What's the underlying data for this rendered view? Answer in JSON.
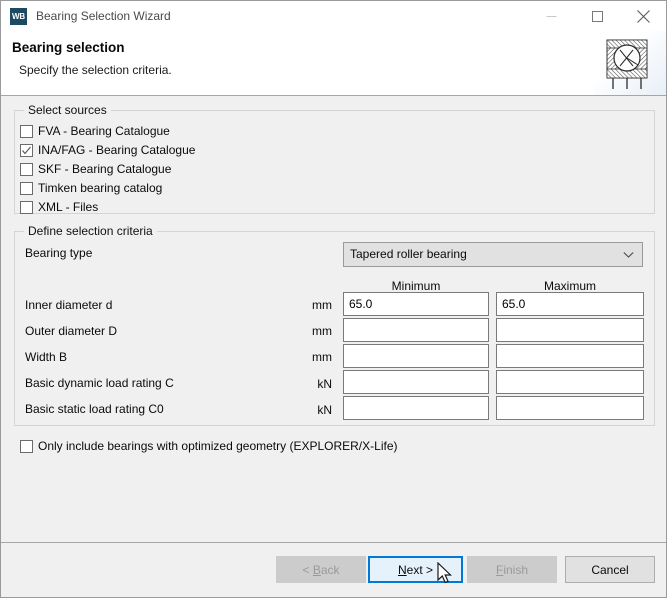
{
  "window": {
    "title": "Bearing Selection Wizard",
    "icon_label": "WB",
    "icon_name": "wb-app-icon",
    "controls": {
      "minimize": "minimize-icon",
      "maximize": "maximize-icon",
      "close": "close-icon"
    }
  },
  "header": {
    "title": "Bearing selection",
    "subtitle": "Specify the selection criteria.",
    "artwork": "bearing-cross-section-illustration"
  },
  "select_sources": {
    "legend": "Select sources",
    "items": [
      {
        "label": "FVA - Bearing Catalogue",
        "checked": false
      },
      {
        "label": "INA/FAG - Bearing Catalogue",
        "checked": true
      },
      {
        "label": "SKF - Bearing Catalogue",
        "checked": false
      },
      {
        "label": "Timken bearing catalog",
        "checked": false
      },
      {
        "label": "XML - Files",
        "checked": false
      }
    ]
  },
  "define_criteria": {
    "legend": "Define selection criteria",
    "bearing_type_label": "Bearing type",
    "bearing_type_value": "Tapered roller bearing",
    "column_headers": {
      "minimum": "Minimum",
      "maximum": "Maximum"
    },
    "rows": [
      {
        "label": "Inner diameter d",
        "unit": "mm",
        "minimum": "65.0",
        "maximum": "65.0"
      },
      {
        "label": "Outer diameter D",
        "unit": "mm",
        "minimum": "",
        "maximum": ""
      },
      {
        "label": "Width B",
        "unit": "mm",
        "minimum": "",
        "maximum": ""
      },
      {
        "label": "Basic dynamic load rating C",
        "unit": "kN",
        "minimum": "",
        "maximum": ""
      },
      {
        "label": "Basic static load rating C0",
        "unit": "kN",
        "minimum": "",
        "maximum": ""
      }
    ],
    "optimized_geometry": {
      "label": "Only include bearings with optimized geometry  (EXPLORER/X-Life)",
      "checked": false
    }
  },
  "footer": {
    "buttons": [
      {
        "label": "< Back",
        "state": "disabled",
        "mnemonic": "B"
      },
      {
        "label": "Next >",
        "state": "focused",
        "mnemonic": "N"
      },
      {
        "label": "Finish",
        "state": "disabled",
        "mnemonic": "F"
      },
      {
        "label": "Cancel",
        "state": "normal",
        "mnemonic": ""
      }
    ]
  },
  "colors": {
    "accent": "#0078d7",
    "focus_fill": "#e5f1fb",
    "dialog_bg": "#f0f0f0",
    "icon_bg": "#1c4a63"
  },
  "cursor": "mouse-pointer"
}
